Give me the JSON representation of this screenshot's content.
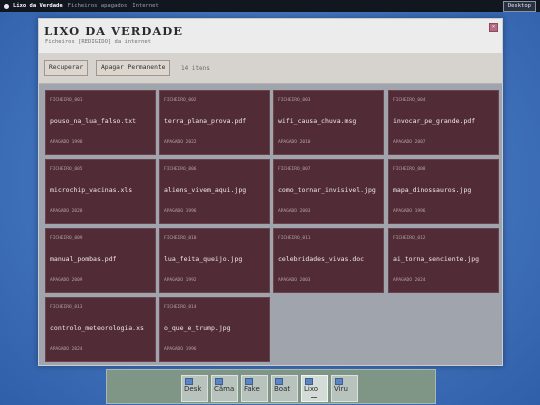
{
  "topbar": {
    "app": "Lixo da Verdade",
    "menus": [
      "Ficheiros apagados",
      "Internet"
    ],
    "desktop_button": "Desktop"
  },
  "window": {
    "title": "LIXO DA VERDADE",
    "subtitle": "Ficheiros [REDIGIDO] da internet",
    "close": "×",
    "toolbar": {
      "recover": "Recuperar",
      "delete_forever": "Apagar Permanente",
      "count": "14 itens"
    }
  },
  "files": [
    {
      "id": "FICHEIRO_001",
      "name": "pouso_na_lua_falso.txt",
      "deleted": "APAGADO 1998"
    },
    {
      "id": "FICHEIRO_002",
      "name": "terra_plana_prova.pdf",
      "deleted": "APAGADO 2022"
    },
    {
      "id": "FICHEIRO_003",
      "name": "wifi_causa_chuva.msg",
      "deleted": "APAGADO 2010"
    },
    {
      "id": "FICHEIRO_004",
      "name": "invocar_pe_grande.pdf",
      "deleted": "APAGADO 2007"
    },
    {
      "id": "FICHEIRO_005",
      "name": "microchip_vacinas.xls",
      "deleted": "APAGADO 2020"
    },
    {
      "id": "FICHEIRO_006",
      "name": "aliens_vivem_aqui.jpg",
      "deleted": "APAGADO 1996"
    },
    {
      "id": "FICHEIRO_007",
      "name": "como_tornar_invisivel.jpg",
      "deleted": "APAGADO 2003"
    },
    {
      "id": "FICHEIRO_008",
      "name": "mapa_dinossauros.jpg",
      "deleted": "APAGADO 1996"
    },
    {
      "id": "FICHEIRO_009",
      "name": "manual_pombas.pdf",
      "deleted": "APAGADO 2009"
    },
    {
      "id": "FICHEIRO_010",
      "name": "lua_feita_queijo.jpg",
      "deleted": "APAGADO 1992"
    },
    {
      "id": "FICHEIRO_011",
      "name": "celebridades_vivas.doc",
      "deleted": "APAGADO 2003"
    },
    {
      "id": "FICHEIRO_012",
      "name": "ai_torna_senciente.jpg",
      "deleted": "APAGADO 2024"
    },
    {
      "id": "FICHEIRO_013",
      "name": "controlo_meteorologia.xs",
      "deleted": "APAGADO 2024"
    },
    {
      "id": "FICHEIRO_014",
      "name": "o_que_e_trump.jpg",
      "deleted": "APAGADO 1996"
    }
  ],
  "taskbar": [
    {
      "label": "Desk",
      "icon": "desktop-icon"
    },
    {
      "label": "Câma",
      "icon": "camera-icon"
    },
    {
      "label": "Fake",
      "icon": "fake-icon"
    },
    {
      "label": "Boat",
      "icon": "boat-icon"
    },
    {
      "label": "Lixo",
      "icon": "trash-icon",
      "active": true
    },
    {
      "label": "Viru",
      "icon": "virus-icon"
    }
  ]
}
